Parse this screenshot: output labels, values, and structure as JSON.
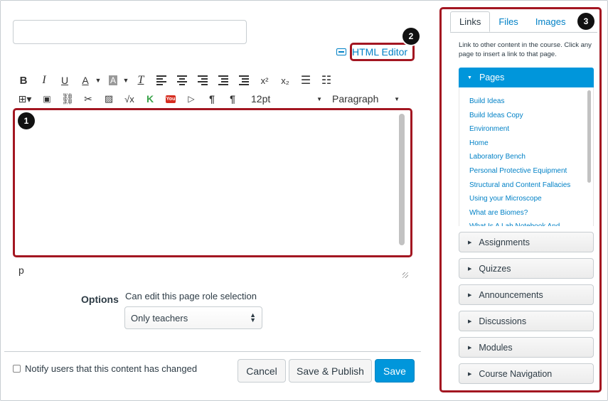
{
  "editor": {
    "title_value": "",
    "html_editor_link": "HTML Editor",
    "toolbar": {
      "bold": "B",
      "italic": "I",
      "underline": "U",
      "text_color": "A",
      "bg_color": "A",
      "clear_format": "T",
      "superscript": "x²",
      "subscript": "x₂",
      "font_size": "12pt",
      "format": "Paragraph"
    },
    "status_path": "p"
  },
  "options": {
    "label": "Options",
    "sublabel": "Can edit this page role selection",
    "role_select_value": "Only teachers"
  },
  "footer": {
    "notify_label": "Notify users that this content has changed",
    "cancel": "Cancel",
    "save_publish": "Save & Publish",
    "save": "Save"
  },
  "sidebar": {
    "tabs": [
      "Links",
      "Files",
      "Images"
    ],
    "help_text": "Link to other content in the course. Click any page to insert a link to that page.",
    "pages_header": "Pages",
    "pages": [
      "Build Ideas",
      "Build Ideas Copy",
      "Environment",
      "Home",
      "Laboratory Bench",
      "Personal Protective Equipment",
      "Structural and Content Fallacies",
      "Using your Microscope",
      "What are Biomes?",
      "What Is A Lab Notebook And..."
    ],
    "sections": [
      "Assignments",
      "Quizzes",
      "Announcements",
      "Discussions",
      "Modules",
      "Course Navigation"
    ]
  },
  "callouts": [
    "1",
    "2",
    "3"
  ],
  "colors": {
    "highlight": "#a31621",
    "link": "#0081c6",
    "primary": "#0096db"
  }
}
